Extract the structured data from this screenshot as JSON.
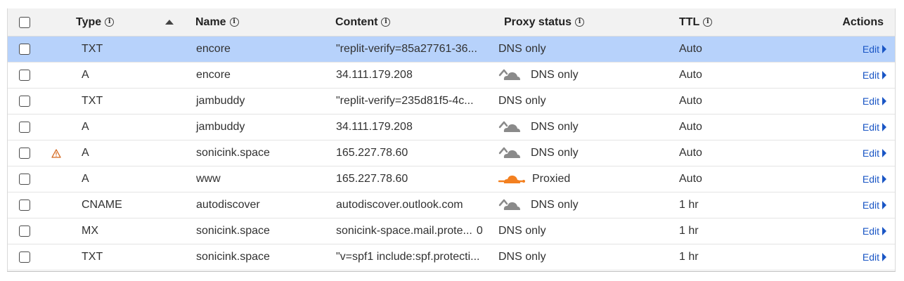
{
  "header": {
    "type": "Type",
    "name": "Name",
    "content": "Content",
    "proxy_status": "Proxy status",
    "ttl": "TTL",
    "actions": "Actions"
  },
  "rows": [
    {
      "type": "TXT",
      "name": "encore",
      "content": "\"replit-verify=85a27761-36...",
      "proxy": "DNS only",
      "proxy_icon": "none",
      "ttl": "Auto",
      "warning": false,
      "selected": true
    },
    {
      "type": "A",
      "name": "encore",
      "content": "34.111.179.208",
      "proxy": "DNS only",
      "proxy_icon": "cloud-dns-only-icon",
      "ttl": "Auto",
      "warning": false,
      "selected": false
    },
    {
      "type": "TXT",
      "name": "jambuddy",
      "content": "\"replit-verify=235d81f5-4c...",
      "proxy": "DNS only",
      "proxy_icon": "none",
      "ttl": "Auto",
      "warning": false,
      "selected": false
    },
    {
      "type": "A",
      "name": "jambuddy",
      "content": "34.111.179.208",
      "proxy": "DNS only",
      "proxy_icon": "cloud-dns-only-icon",
      "ttl": "Auto",
      "warning": false,
      "selected": false
    },
    {
      "type": "A",
      "name": "sonicink.space",
      "content": "165.227.78.60",
      "proxy": "DNS only",
      "proxy_icon": "cloud-dns-only-icon",
      "ttl": "Auto",
      "warning": true,
      "selected": false
    },
    {
      "type": "A",
      "name": "www",
      "content": "165.227.78.60",
      "proxy": "Proxied",
      "proxy_icon": "cloud-proxied-icon",
      "ttl": "Auto",
      "warning": false,
      "selected": false
    },
    {
      "type": "CNAME",
      "name": "autodiscover",
      "content": "autodiscover.outlook.com",
      "proxy": "DNS only",
      "proxy_icon": "cloud-dns-only-icon",
      "ttl": "1 hr",
      "warning": false,
      "selected": false
    },
    {
      "type": "MX",
      "name": "sonicink.space",
      "content": "sonicink-space.mail.prote...",
      "priority": "0",
      "proxy": "DNS only",
      "proxy_icon": "none",
      "ttl": "1 hr",
      "warning": false,
      "selected": false
    },
    {
      "type": "TXT",
      "name": "sonicink.space",
      "content": "\"v=spf1 include:spf.protecti...",
      "proxy": "DNS only",
      "proxy_icon": "none",
      "ttl": "1 hr",
      "warning": false,
      "selected": false
    }
  ],
  "edit_label": "Edit",
  "info_glyph": "i",
  "colors": {
    "selected_row": "#b7d2fb",
    "header_bg": "#f2f2f2",
    "link": "#1a56c5",
    "cloud_gray": "#8a8a8a",
    "cloud_orange": "#f38020",
    "warning": "#d4661c"
  }
}
